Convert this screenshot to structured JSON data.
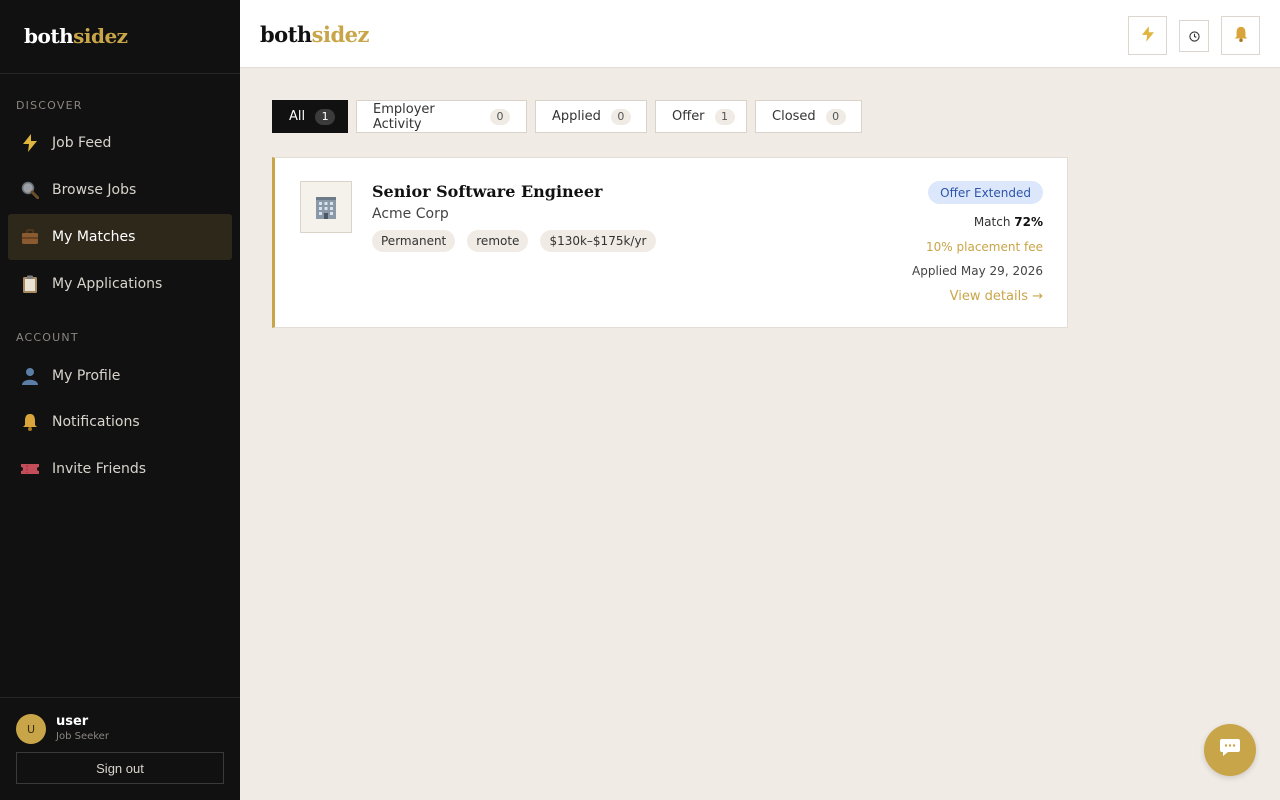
{
  "brand": {
    "part1": "both",
    "part2": "sidez"
  },
  "sidebar": {
    "discover_label": "DISCOVER",
    "account_label": "ACCOUNT",
    "discover_items": [
      {
        "label": "Job Feed",
        "icon": "lightning-icon",
        "active": false
      },
      {
        "label": "Browse Jobs",
        "icon": "magnifier-icon",
        "active": false
      },
      {
        "label": "My Matches",
        "icon": "briefcase-icon",
        "active": true
      },
      {
        "label": "My Applications",
        "icon": "clipboard-icon",
        "active": false
      }
    ],
    "account_items": [
      {
        "label": "My Profile",
        "icon": "person-icon"
      },
      {
        "label": "Notifications",
        "icon": "bell-icon"
      },
      {
        "label": "Invite Friends",
        "icon": "ticket-icon"
      }
    ],
    "user": {
      "initial": "U",
      "name": "user",
      "role": "Job Seeker"
    },
    "signout_label": "Sign out"
  },
  "header": {
    "buttons": [
      "lightning-icon",
      "clock-icon",
      "bell-icon"
    ]
  },
  "tabs": [
    {
      "label": "All",
      "count": "1",
      "active": true
    },
    {
      "label": "Employer Activity",
      "count": "0",
      "active": false
    },
    {
      "label": "Applied",
      "count": "0",
      "active": false
    },
    {
      "label": "Offer",
      "count": "1",
      "active": false
    },
    {
      "label": "Closed",
      "count": "0",
      "active": false
    }
  ],
  "match_card": {
    "logo_icon": "office-building-icon",
    "title": "Senior Software Engineer",
    "company": "Acme Corp",
    "tags": [
      "Permanent",
      "remote",
      "$130k–$175k/yr"
    ],
    "status": "Offer Extended",
    "match_label": "Match",
    "match_value": "72%",
    "fee": "10% placement fee",
    "applied": "Applied May 29, 2026",
    "details_link": "View details →"
  },
  "colors": {
    "accent": "#c9a549",
    "sidebar_bg": "#111111",
    "page_bg": "#f0ebe5",
    "status_badge_bg": "#dce7fb",
    "status_badge_text": "#2e55a8"
  }
}
